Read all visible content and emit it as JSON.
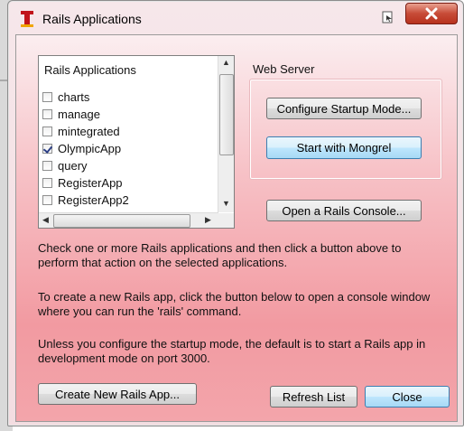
{
  "window": {
    "title": "Rails Applications"
  },
  "list": {
    "header": "Rails Applications",
    "items": [
      {
        "label": "charts",
        "checked": false
      },
      {
        "label": "manage",
        "checked": false
      },
      {
        "label": "mintegrated",
        "checked": false
      },
      {
        "label": "OlympicApp",
        "checked": true
      },
      {
        "label": "query",
        "checked": false
      },
      {
        "label": "RegisterApp",
        "checked": false
      },
      {
        "label": "RegisterApp2",
        "checked": false
      }
    ]
  },
  "web_server": {
    "title": "Web Server",
    "configure_label": "Configure Startup Mode...",
    "start_label": "Start with Mongrel"
  },
  "console_label": "Open a Rails Console...",
  "descriptions": {
    "p1": "Check one or more Rails applications and then click a button above to perform that action on the selected applications.",
    "p2": "To create a new Rails app, click the button below to open a console window where you can run the 'rails' command.",
    "p3": "Unless you configure the startup mode, the default is to start a Rails app in development mode on port 3000."
  },
  "buttons": {
    "create_label": "Create New Rails App...",
    "refresh_label": "Refresh List",
    "close_label": "Close"
  },
  "icons": {
    "app": "app-logo-icon",
    "help": "help-icon",
    "close": "close-icon"
  },
  "colors": {
    "accent_red": "#c74b37",
    "focus_blue": "#3c7fb1",
    "client_pink": "#f29aa1"
  }
}
